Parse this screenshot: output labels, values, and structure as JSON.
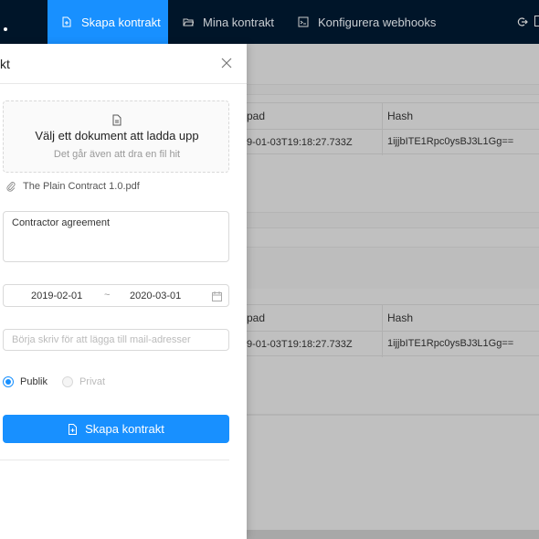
{
  "nav": {
    "items": [
      {
        "label": "Skapa kontrakt",
        "icon": "file-add-icon",
        "active": true
      },
      {
        "label": "Mina kontrakt",
        "icon": "folder-open-icon",
        "active": false
      },
      {
        "label": "Konfigurera webhooks",
        "icon": "code-icon",
        "active": false
      }
    ],
    "right_icons": [
      "logout-icon"
    ]
  },
  "background": {
    "table1": {
      "headers": [
        "pad",
        "Hash"
      ],
      "row": [
        "9-01-03T19:18:27.733Z",
        "1ijjbITE1Rpc0ysBJ3L1Gg=="
      ]
    },
    "table2": {
      "headers": [
        "pad",
        "Hash"
      ],
      "row": [
        "9-01-03T19:18:27.733Z",
        "1ijjbITE1Rpc0ysBJ3L1Gg=="
      ]
    }
  },
  "drawer": {
    "title": "kt",
    "close_icon": "close-icon",
    "upload": {
      "text": "Välj ett dokument att ladda upp",
      "hint": "Det går även att dra en fil hit"
    },
    "file_name": "The Plain Contract 1.0.pdf",
    "description_value": "Contractor agreement",
    "date_start": "2019-02-01",
    "date_sep": "~",
    "date_end": "2020-03-01",
    "mail_placeholder": "Börja skriv för att lägga till mail-adresser",
    "radio_public": "Publik",
    "radio_private": "Privat",
    "submit_label": "Skapa kontrakt"
  },
  "colors": {
    "primary": "#1890ff",
    "nav_bg": "#001529",
    "overlay": "#bfbfbf"
  }
}
